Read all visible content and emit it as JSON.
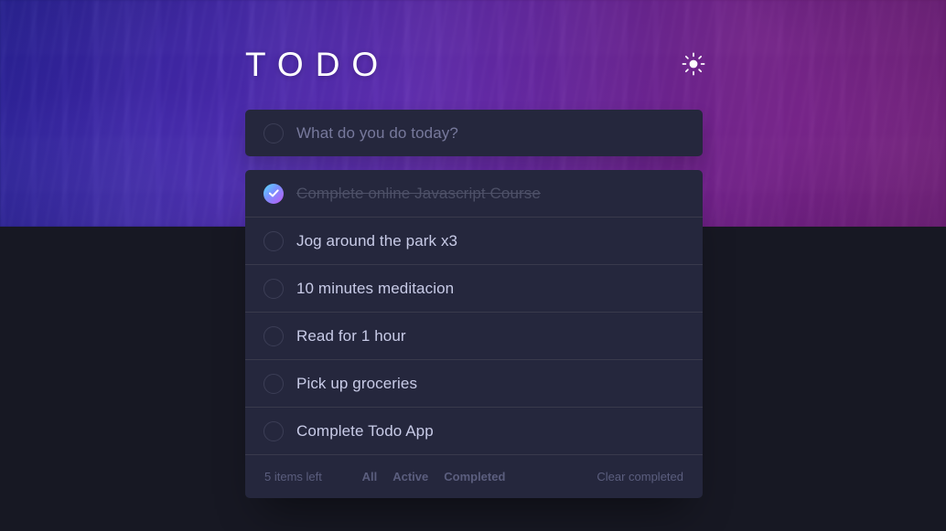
{
  "app": {
    "title": "TODO",
    "theme_toggle_icon": "sun-icon"
  },
  "new_todo": {
    "value": "",
    "placeholder": "What do you do today?"
  },
  "todos": [
    {
      "label": "Complete online Javascript Course",
      "completed": true
    },
    {
      "label": "Jog around the park x3",
      "completed": false
    },
    {
      "label": "10 minutes meditacion",
      "completed": false
    },
    {
      "label": "Read for 1 hour",
      "completed": false
    },
    {
      "label": "Pick up groceries",
      "completed": false
    },
    {
      "label": "Complete Todo App",
      "completed": false
    }
  ],
  "footer": {
    "items_left": "5 items left",
    "filters": [
      {
        "label": "All",
        "active": true
      },
      {
        "label": "Active",
        "active": false
      },
      {
        "label": "Completed",
        "active": false
      }
    ],
    "clear_label": "Clear completed"
  },
  "colors": {
    "page_background": "#171823",
    "card_background": "#25273d",
    "divider": "#393a4c",
    "text_primary": "#c8cbe7",
    "text_muted": "#5b5e7e",
    "text_completed": "#4d5067",
    "check_gradient_start": "#57ddff",
    "check_gradient_end": "#c058f3",
    "hero_gradient_start": "#2e2ac8",
    "hero_gradient_end": "#96248c"
  }
}
